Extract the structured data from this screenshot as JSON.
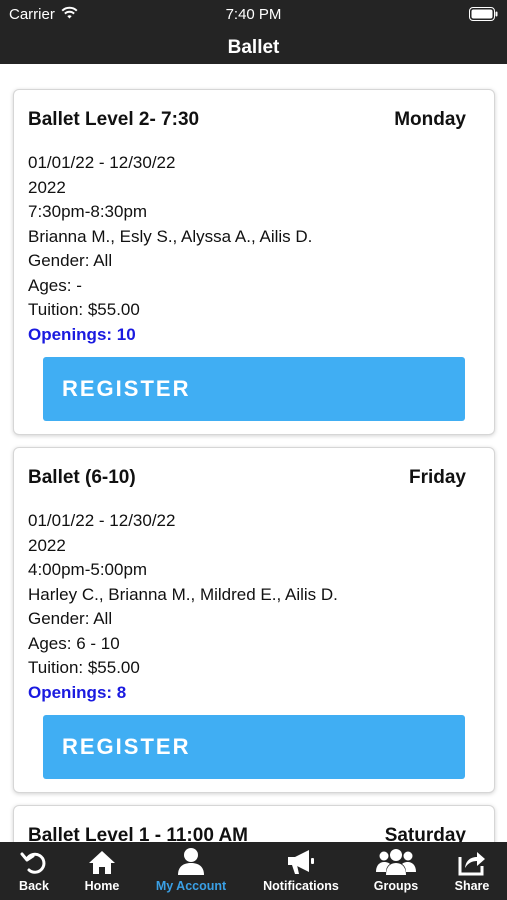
{
  "status_bar": {
    "carrier": "Carrier",
    "time": "7:40 PM"
  },
  "nav": {
    "title": "Ballet"
  },
  "classes": [
    {
      "title": "Ballet Level 2- 7:30",
      "day": "Monday",
      "date_range": "01/01/22 - 12/30/22",
      "year": "2022",
      "time": "7:30pm-8:30pm",
      "instructors": "Brianna M., Esly S., Alyssa A., Ailis D.",
      "gender": "Gender: All",
      "ages": "Ages: -",
      "tuition": "Tuition: $55.00",
      "openings": "Openings: 10",
      "register_label": "REGISTER"
    },
    {
      "title": "Ballet (6-10)",
      "day": "Friday",
      "date_range": "01/01/22 - 12/30/22",
      "year": "2022",
      "time": "4:00pm-5:00pm",
      "instructors": "Harley C., Brianna M., Mildred E., Ailis D.",
      "gender": "Gender: All",
      "ages": "Ages: 6 - 10",
      "tuition": "Tuition: $55.00",
      "openings": "Openings: 8",
      "register_label": "REGISTER"
    },
    {
      "title": "Ballet Level 1 - 11:00 AM",
      "day": "Saturday"
    }
  ],
  "tabs": [
    {
      "label": "Back",
      "icon": "back-arrow-icon"
    },
    {
      "label": "Home",
      "icon": "home-icon"
    },
    {
      "label": "My Account",
      "icon": "user-icon"
    },
    {
      "label": "Notifications",
      "icon": "megaphone-icon"
    },
    {
      "label": "Groups",
      "icon": "groups-icon"
    },
    {
      "label": "Share",
      "icon": "share-icon"
    }
  ],
  "colors": {
    "bar_background": "#242424",
    "register_button": "#40aef3",
    "openings_text": "#1a1ae0",
    "active_tab": "#3aa0e6"
  }
}
